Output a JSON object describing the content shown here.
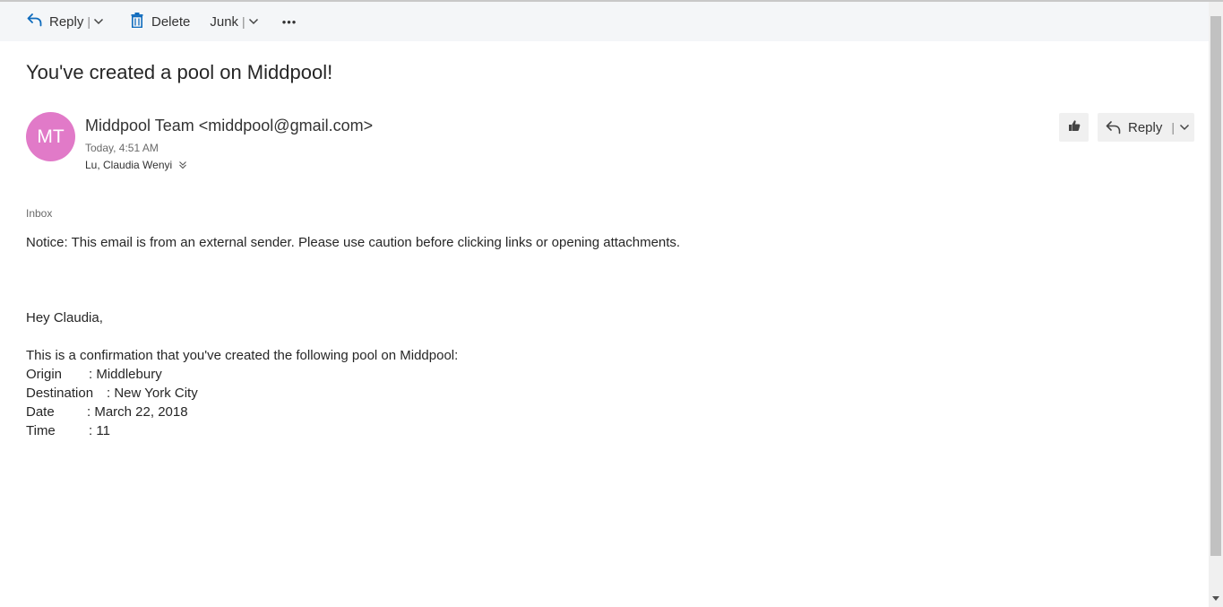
{
  "toolbar": {
    "reply_label": "Reply",
    "delete_label": "Delete",
    "junk_label": "Junk",
    "more_label": "•••"
  },
  "message": {
    "subject": "You've created a pool on Middpool!",
    "avatar_initials": "MT",
    "avatar_color": "#e17ac8",
    "sender": "Middpool Team <middpool@gmail.com>",
    "sent_time": "Today, 4:51 AM",
    "recipients": "Lu, Claudia Wenyi",
    "reply_button_label": "Reply",
    "folder": "Inbox",
    "notice": "Notice: This email is from an external sender. Please use caution before clicking links or opening attachments.",
    "greeting": "Hey Claudia,",
    "confirmation": "This is a confirmation that you've created the following pool on Middpool:",
    "details": [
      {
        "label": "Origin",
        "value": ": Middlebury"
      },
      {
        "label": "Destination",
        "value": ": New York City"
      },
      {
        "label": "Date",
        "value": ": March 22, 2018"
      },
      {
        "label": "Time",
        "value": ": 11"
      }
    ]
  },
  "colors": {
    "accent": "#0f6cbd",
    "toolbar_bg": "#f4f6f8"
  }
}
